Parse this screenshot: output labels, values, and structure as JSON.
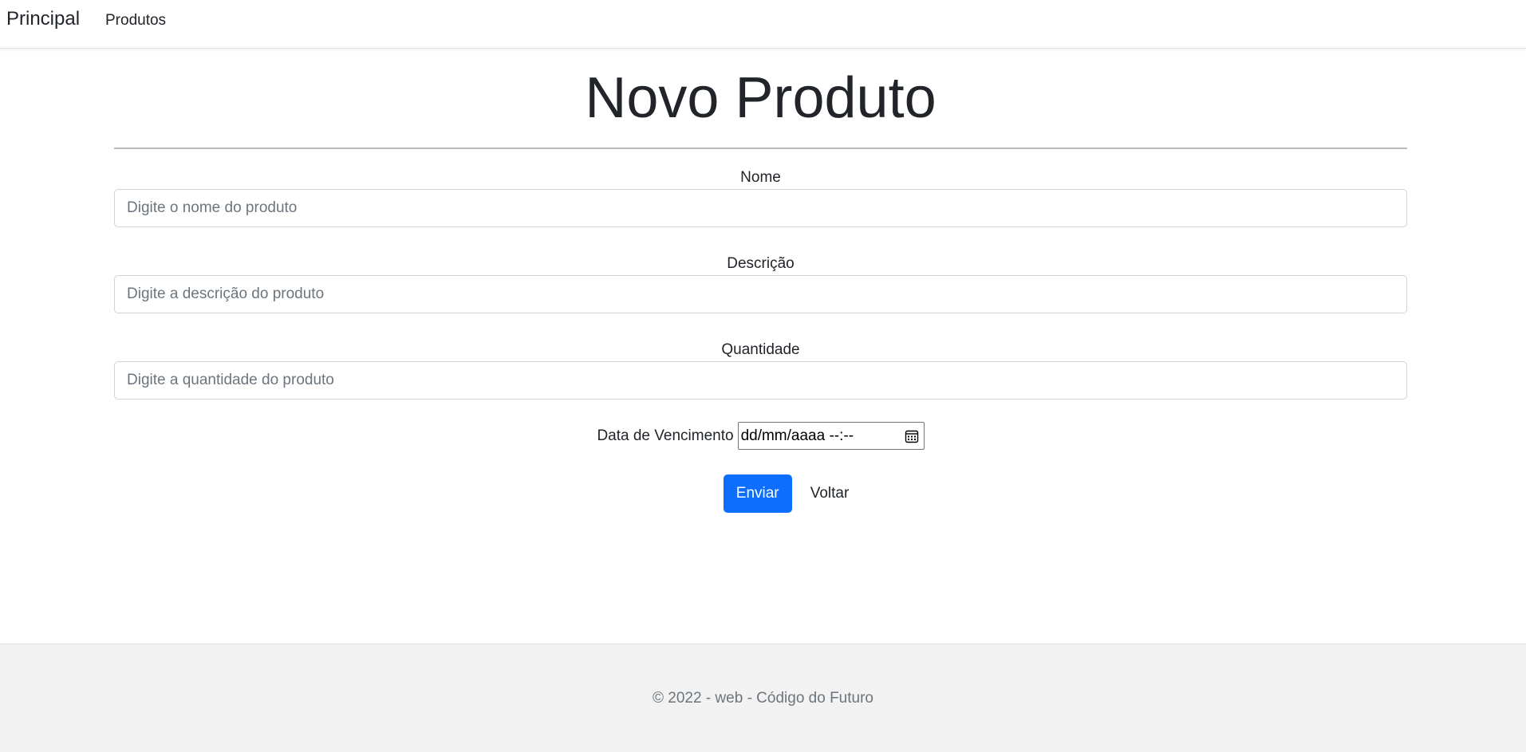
{
  "navbar": {
    "brand": "Principal",
    "links": [
      {
        "label": "Produtos"
      }
    ]
  },
  "page": {
    "title": "Novo Produto"
  },
  "form": {
    "nome": {
      "label": "Nome",
      "placeholder": "Digite o nome do produto",
      "value": ""
    },
    "descricao": {
      "label": "Descrição",
      "placeholder": "Digite a descrição do produto",
      "value": ""
    },
    "quantidade": {
      "label": "Quantidade",
      "placeholder": "Digite a quantidade do produto",
      "value": ""
    },
    "vencimento": {
      "label": "Data de Vencimento",
      "display": "dd/mm/aaaa --:--"
    },
    "submit_label": "Enviar",
    "back_label": "Voltar"
  },
  "footer": {
    "text": "© 2022 - web - Código do Futuro"
  },
  "colors": {
    "primary": "#0d6efd",
    "footer_bg": "#f2f2f2",
    "muted_text": "#6c757d"
  },
  "icons": {
    "date_picker": "calendar-icon"
  }
}
